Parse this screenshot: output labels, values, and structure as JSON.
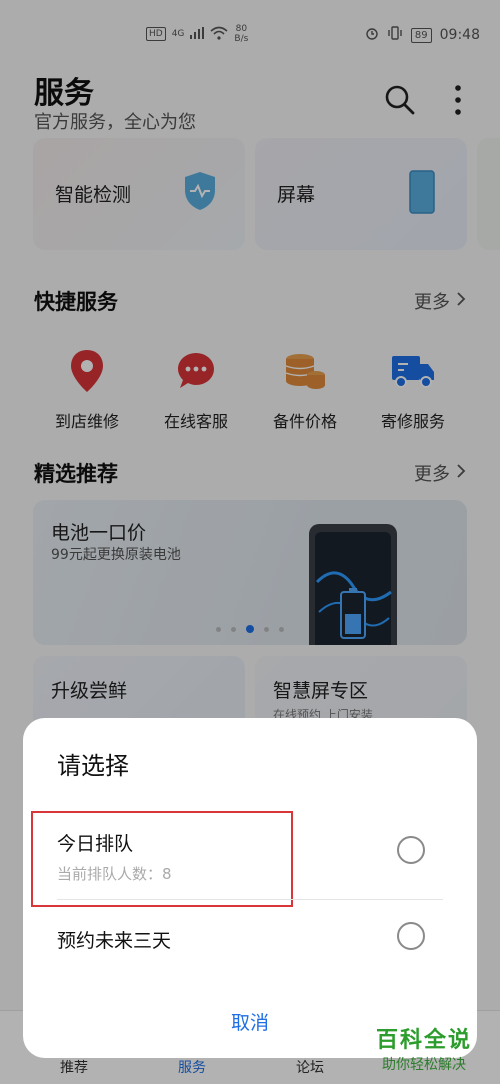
{
  "status_bar": {
    "hd_badge": "HD",
    "network": "4G",
    "speed_value": "80",
    "speed_unit": "B/s",
    "battery": "89",
    "time": "09:48"
  },
  "header": {
    "title": "服务",
    "subtitle": "官方服务，全心为您",
    "search_icon": "search-icon",
    "more_icon": "more-vertical-icon"
  },
  "top_cards": [
    {
      "label": "智能检测",
      "icon": "shield-icon"
    },
    {
      "label": "屏幕",
      "icon": "phone-screen-icon"
    }
  ],
  "quick_services": {
    "title": "快捷服务",
    "more": "更多",
    "items": [
      {
        "label": "到店维修",
        "icon": "location-pin-icon",
        "color": "#d9363a"
      },
      {
        "label": "在线客服",
        "icon": "chat-bubble-icon",
        "color": "#d9363a"
      },
      {
        "label": "备件价格",
        "icon": "coins-icon",
        "color": "#e08a3a"
      },
      {
        "label": "寄修服务",
        "icon": "truck-icon",
        "color": "#1f6fe6"
      }
    ]
  },
  "featured": {
    "title": "精选推荐",
    "more": "更多",
    "banner": {
      "title": "电池一口价",
      "subtitle": "99元起更换原装电池"
    },
    "cards": [
      {
        "title": "升级尝鲜"
      },
      {
        "title": "智慧屏专区",
        "subtitle": "在线预约 上门安装"
      }
    ]
  },
  "bottom_nav": {
    "items": [
      "推荐",
      "服务",
      "论坛"
    ]
  },
  "dialog": {
    "title": "请选择",
    "options": [
      {
        "title": "今日排队",
        "subtitle": "当前排队人数：8"
      },
      {
        "title": "预约未来三天"
      }
    ],
    "cancel": "取消"
  },
  "watermark": {
    "main": "百科全说",
    "sub": "助你轻松解决"
  },
  "colors": {
    "accent": "#1f6fe6",
    "highlight": "#d9363a"
  }
}
